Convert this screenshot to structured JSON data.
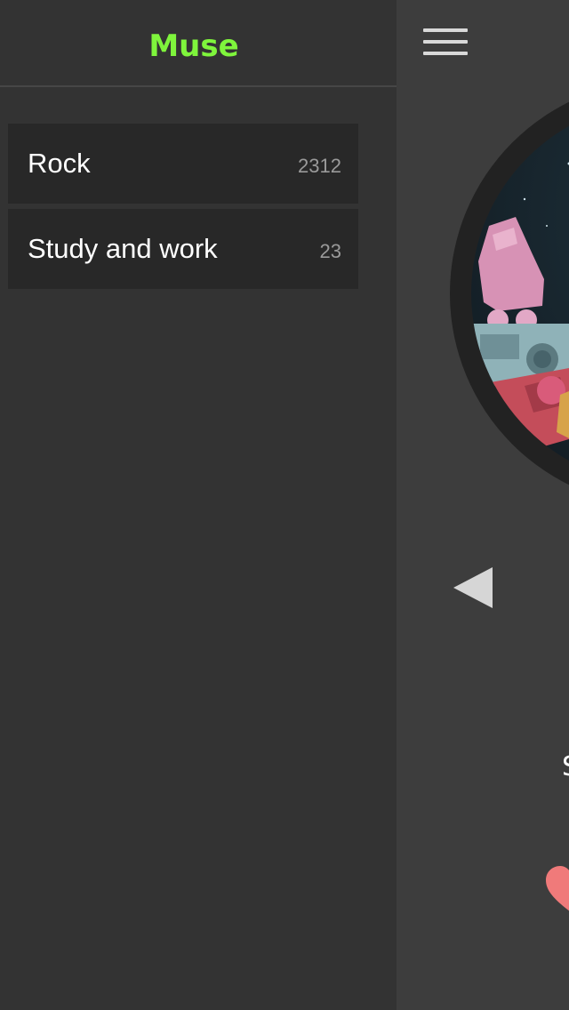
{
  "drawer": {
    "title": "Muse",
    "title_color": "#7ff53c",
    "playlists": [
      {
        "name": "Rock",
        "count": "2312"
      },
      {
        "name": "Study and work",
        "count": "23"
      }
    ]
  },
  "player": {
    "menu_icon": "hamburger-menu-icon",
    "prev_icon": "previous-track-icon",
    "like_icon": "heart-icon",
    "title_fragment": "S",
    "heart_color": "#f07a7a"
  }
}
